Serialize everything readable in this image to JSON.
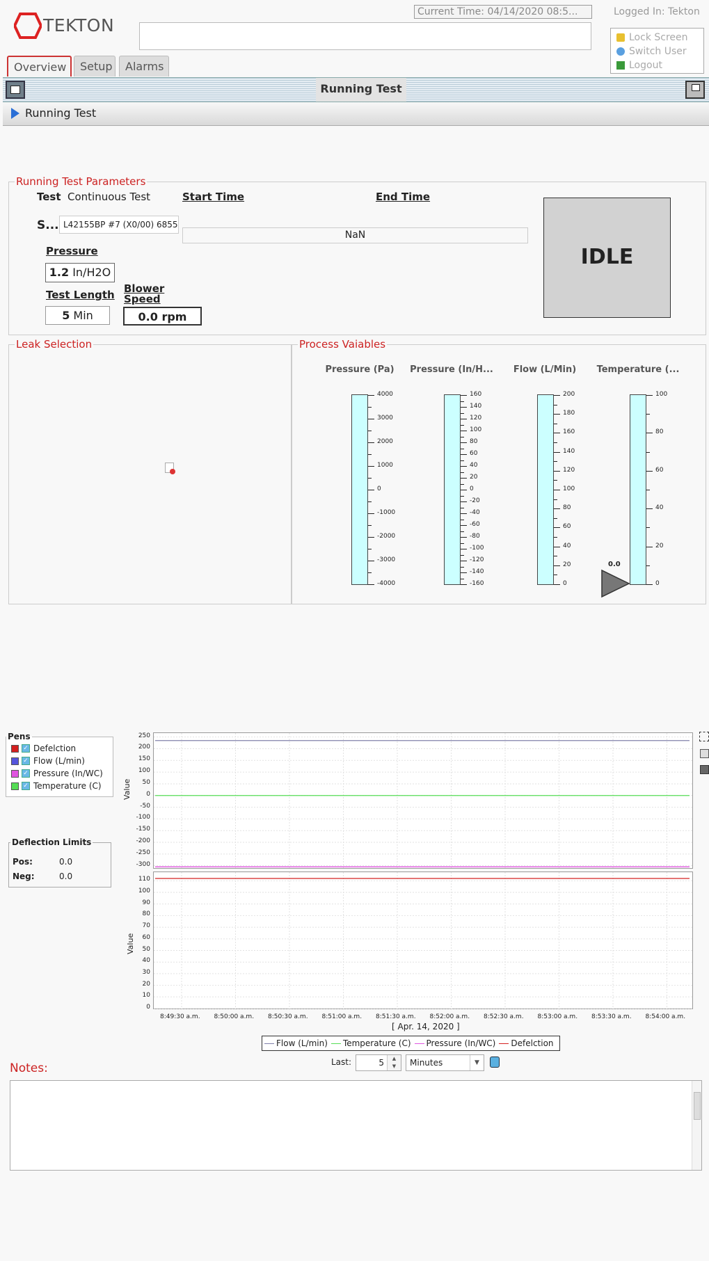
{
  "header": {
    "brand": "TEKTON",
    "current_time": "Current Time: 04/14/2020 08:5...",
    "logged_in": "Logged In: Tekton",
    "user_menu": [
      "Lock Screen",
      "Switch User",
      "Logout"
    ]
  },
  "tabs": [
    "Overview",
    "Setup",
    "Alarms"
  ],
  "window": {
    "title": "Running Test",
    "breadcrumb": "Running Test"
  },
  "params": {
    "legend": "Running Test Parameters",
    "test_label": "Test",
    "test_value": "Continuous Test",
    "start_time_label": "Start Time",
    "end_time_label": "End Time",
    "serial_label": "S...",
    "serial_value": "L42155BP #7 (X0/00) 6855",
    "end_time_value": "NaN",
    "pressure_label": "Pressure",
    "pressure_num": "1.2",
    "pressure_unit": "In/H2O",
    "test_length_label": "Test Length",
    "test_length_num": "5",
    "test_length_unit": "Min",
    "blower_label": "Blower Speed",
    "blower_value": "0.0 rpm",
    "status": "IDLE"
  },
  "leak": {
    "legend": "Leak Selection"
  },
  "process": {
    "legend": "Process Vaiables",
    "gauges": [
      {
        "title": "Pressure (Pa)",
        "labels": [
          "4000",
          "3000",
          "2000",
          "1000",
          "0",
          "-1000",
          "-2000",
          "-3000",
          "-4000"
        ]
      },
      {
        "title": "Pressure (In/H...",
        "labels": [
          "160",
          "140",
          "120",
          "100",
          "80",
          "60",
          "40",
          "20",
          "0",
          "-20",
          "-40",
          "-60",
          "-80",
          "-100",
          "-120",
          "-140",
          "-160"
        ]
      },
      {
        "title": "Flow (L/Min)",
        "labels": [
          "200",
          "180",
          "160",
          "140",
          "120",
          "100",
          "80",
          "60",
          "40",
          "20",
          "0"
        ]
      },
      {
        "title": "Temperature (...",
        "labels": [
          "100",
          "80",
          "60",
          "40",
          "20",
          "0"
        ],
        "pointer_value": "0.0"
      }
    ]
  },
  "pens": {
    "title": "Pens",
    "items": [
      {
        "name": "Defelction",
        "color": "#d42020"
      },
      {
        "name": "Flow (L/min)",
        "color": "#5555dd"
      },
      {
        "name": "Pressure (In/WC)",
        "color": "#e055e0"
      },
      {
        "name": "Temperature (C)",
        "color": "#55dd55"
      }
    ]
  },
  "limits": {
    "title": "Deflection Limits",
    "pos_label": "Pos:",
    "pos_value": "0.0",
    "neg_label": "Neg:",
    "neg_value": "0.0"
  },
  "chart_data": [
    {
      "type": "line",
      "ylabel": "Value",
      "ylim": [
        -310,
        255
      ],
      "yticks": [
        "250",
        "200",
        "150",
        "100",
        "50",
        "0",
        "-50",
        "-100",
        "-150",
        "-200",
        "-250",
        "-300"
      ],
      "series": [
        {
          "name": "Flow (L/min)",
          "color": "#8080aa",
          "values": [
            235,
            235
          ]
        },
        {
          "name": "Temperature (C)",
          "color": "#55dd55",
          "values": [
            0,
            0
          ]
        },
        {
          "name": "Pressure (In/WC)",
          "color": "#e055e0",
          "values": [
            -305,
            -305
          ]
        }
      ],
      "grid": true
    },
    {
      "type": "line",
      "ylabel": "Value",
      "ylim": [
        0,
        115
      ],
      "yticks": [
        "110",
        "100",
        "90",
        "80",
        "70",
        "60",
        "50",
        "40",
        "30",
        "20",
        "10",
        "0"
      ],
      "x": [
        "8:49:30 a.m.",
        "8:50:00 a.m.",
        "8:50:30 a.m.",
        "8:51:00 a.m.",
        "8:51:30 a.m.",
        "8:52:00 a.m.",
        "8:52:30 a.m.",
        "8:53:00 a.m.",
        "8:53:30 a.m.",
        "8:54:00 a.m."
      ],
      "xlabel": "[ Apr. 14, 2020 ]",
      "series": [
        {
          "name": "Defelction",
          "color": "#d42020",
          "values": [
            112,
            112
          ]
        }
      ],
      "grid": true
    }
  ],
  "legend_items": [
    {
      "name": "Flow (L/min)",
      "color": "#8080aa"
    },
    {
      "name": "Temperature (C)",
      "color": "#55dd55"
    },
    {
      "name": "Pressure (In/WC)",
      "color": "#e055e0"
    },
    {
      "name": "Defelction",
      "color": "#d42020"
    }
  ],
  "range": {
    "last_label": "Last:",
    "last_value": "5",
    "unit": "Minutes"
  },
  "notes": {
    "label": "Notes:"
  }
}
